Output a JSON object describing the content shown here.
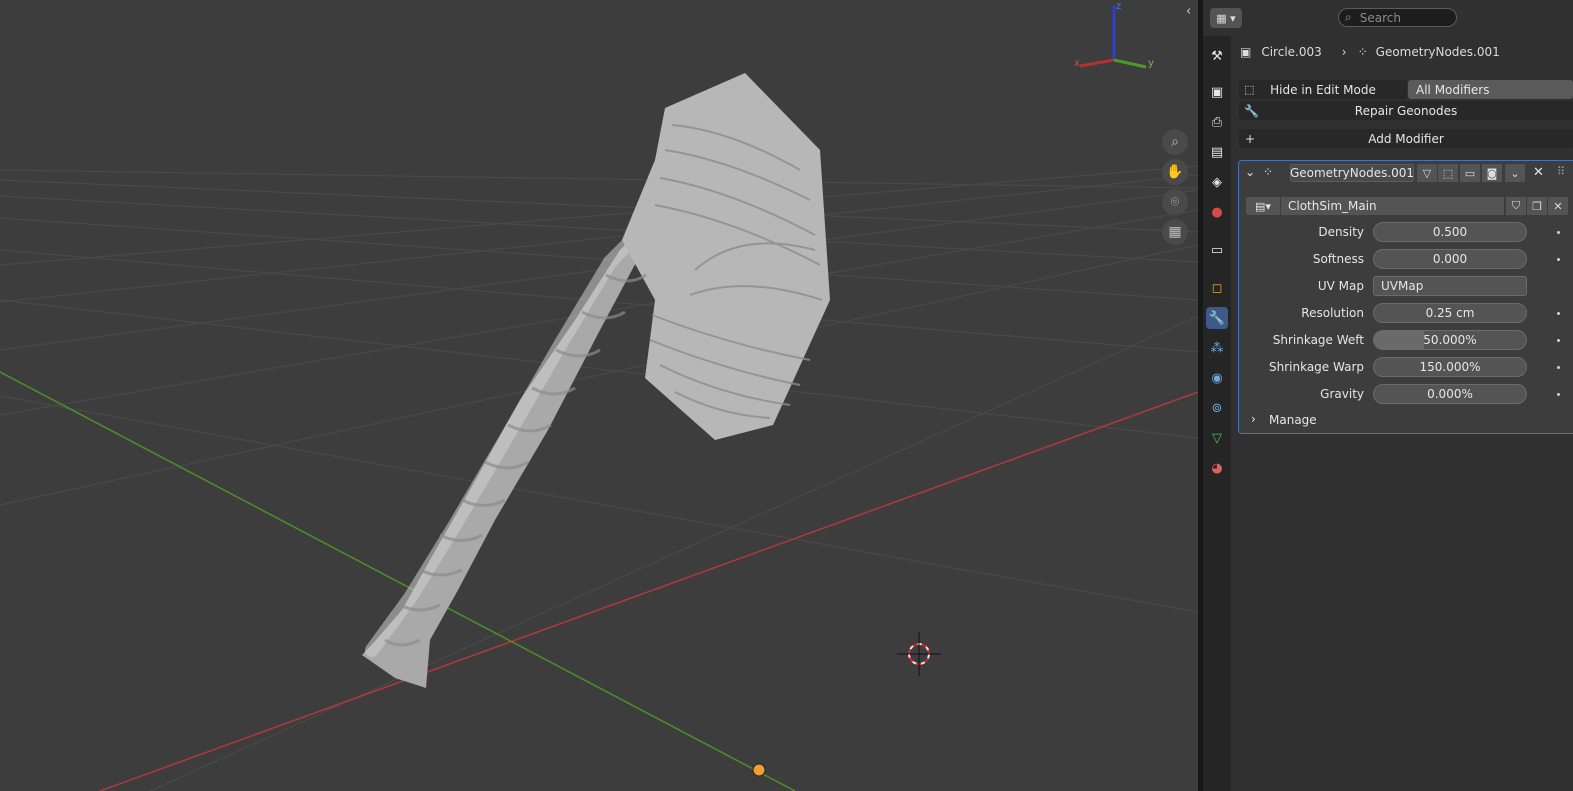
{
  "viewport": {
    "gizmo": {
      "x_label": "x",
      "y_label": "y",
      "z_label": "z"
    },
    "nav_icons": [
      "zoom-icon",
      "pan-hand-icon",
      "camera-icon",
      "grid-perspective-icon"
    ],
    "colors": {
      "background": "#3d3d3d",
      "x_axis": "#a83a3a",
      "y_axis": "#4c8a2a",
      "grid": "#4a4a4a",
      "mesh": "#b9b9b9"
    }
  },
  "properties": {
    "search": {
      "placeholder": "Search"
    },
    "breadcrumb": {
      "object": "Circle.003",
      "modifier": "GeometryNodes.001"
    },
    "buttons": {
      "hide_in_edit_mode": "Hide in Edit Mode",
      "all_modifiers": "All Modifiers",
      "repair_geonodes": "Repair Geonodes",
      "add_modifier": "Add Modifier"
    },
    "modifier": {
      "name": "GeometryNodes.001",
      "node_group": "ClothSim_Main",
      "params": [
        {
          "label": "Density",
          "value": "0.500",
          "kind": "number"
        },
        {
          "label": "Softness",
          "value": "0.000",
          "kind": "number"
        },
        {
          "label": "UV Map",
          "value": "UVMap",
          "kind": "text"
        },
        {
          "label": "Resolution",
          "value": "0.25 cm",
          "kind": "number"
        },
        {
          "label": "Shrinkage Weft",
          "value": "50.000%",
          "kind": "slider",
          "fraction": 0.33
        },
        {
          "label": "Shrinkage Warp",
          "value": "150.000%",
          "kind": "number"
        },
        {
          "label": "Gravity",
          "value": "0.000%",
          "kind": "number"
        }
      ],
      "manage_label": "Manage"
    },
    "accent": "#4772b3"
  }
}
